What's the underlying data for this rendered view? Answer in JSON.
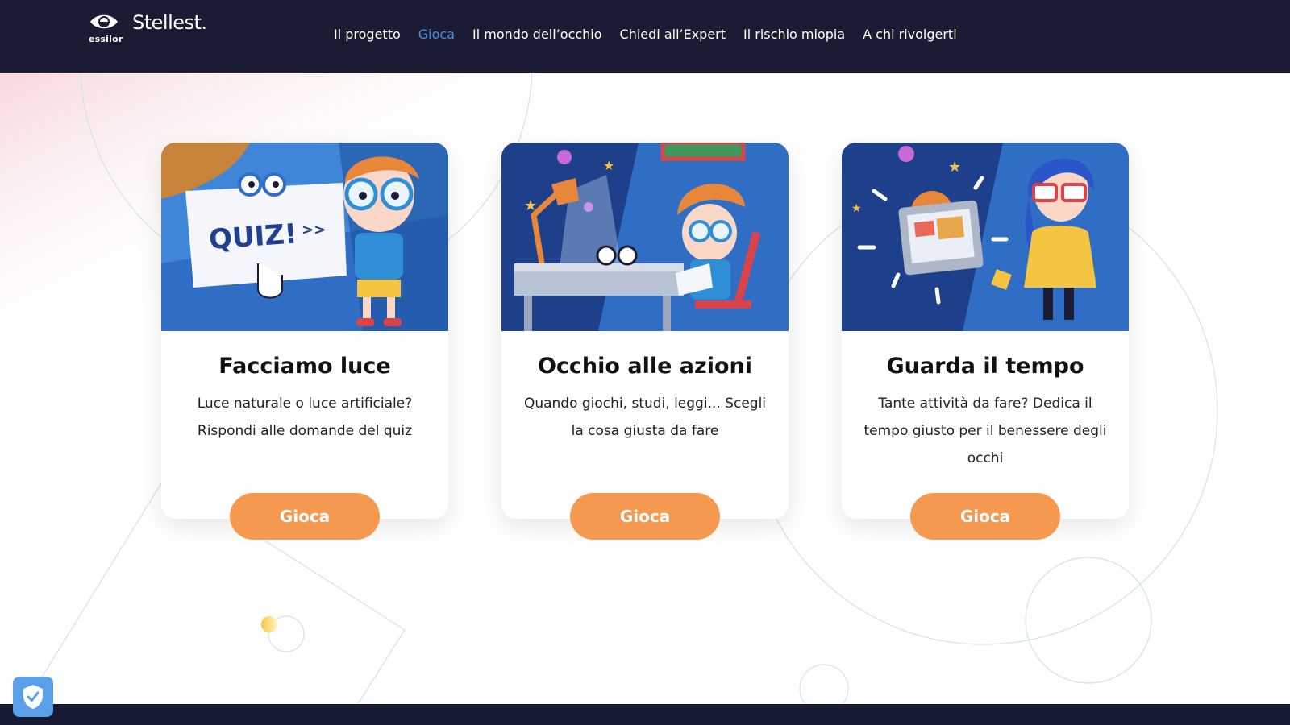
{
  "brand": {
    "company": "essilor",
    "product": "Stellest."
  },
  "nav": {
    "items": [
      {
        "label": "Il progetto",
        "active": false
      },
      {
        "label": "Gioca",
        "active": true
      },
      {
        "label": "Il mondo dell’occhio",
        "active": false
      },
      {
        "label": "Chiedi all’Expert",
        "active": false
      },
      {
        "label": "Il rischio miopia",
        "active": false
      },
      {
        "label": "A chi rivolgerti",
        "active": false
      }
    ]
  },
  "cards": [
    {
      "image_sign_text": "QUIZ!",
      "image_sign_arrows": ">>",
      "title": "Facciamo luce",
      "text": "Luce naturale o luce artificiale? Rispondi alle domande del quiz",
      "button": "Gioca"
    },
    {
      "title": "Occhio alle azioni",
      "text": "Quando giochi, studi, leggi... Scegli la cosa giusta da fare",
      "button": "Gioca"
    },
    {
      "title": "Guarda il tempo",
      "text": "Tante attività da fare? Dedica il tempo giusto per il benessere degli occhi",
      "button": "Gioca"
    }
  ],
  "colors": {
    "header_bg": "#1b1b33",
    "active_link": "#4a90e2",
    "button_bg": "#f4994f",
    "cookie_shield": "#5aa0e8"
  },
  "icons": [
    "eye-logo-icon",
    "shield-check-icon"
  ]
}
